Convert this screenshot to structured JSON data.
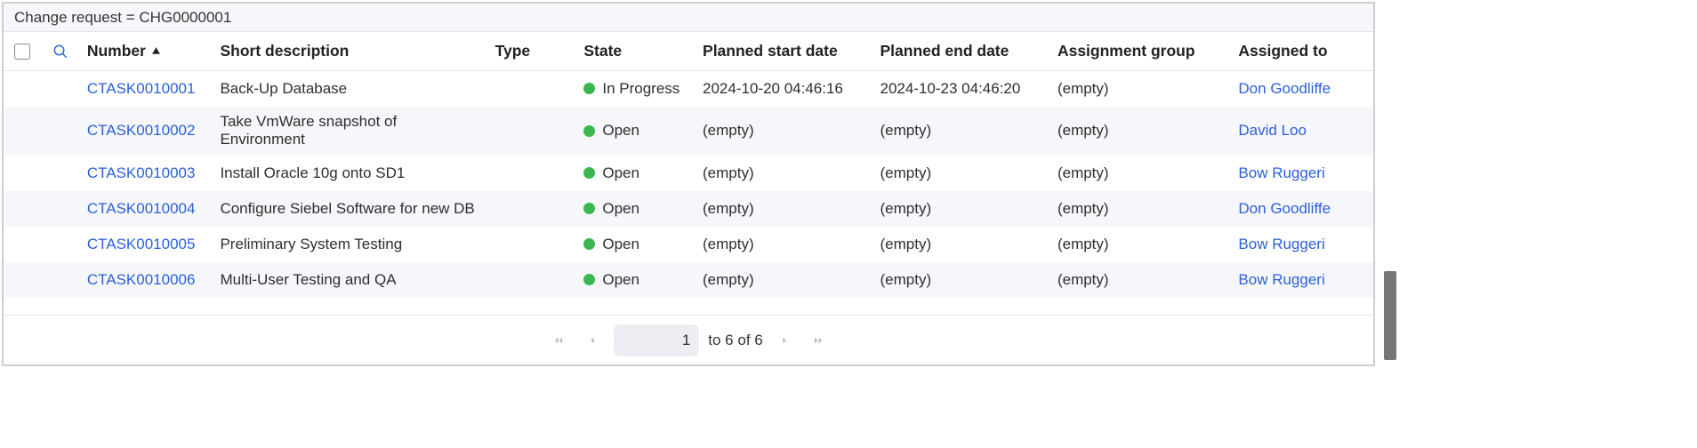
{
  "titlebar": "Change request = CHG0000001",
  "columns": {
    "number": "Number",
    "short_description": "Short description",
    "type": "Type",
    "state": "State",
    "planned_start": "Planned start date",
    "planned_end": "Planned end date",
    "assignment_group": "Assignment group",
    "assigned_to": "Assigned to"
  },
  "sort": {
    "column": "number",
    "direction": "asc"
  },
  "state_color": "#3bb650",
  "rows": [
    {
      "number": "CTASK0010001",
      "short_description": "Back-Up Database",
      "type": "",
      "state": "In Progress",
      "planned_start": "2024-10-20 04:46:16",
      "planned_end": "2024-10-23 04:46:20",
      "assignment_group": "(empty)",
      "assigned_to": "Don Goodliffe"
    },
    {
      "number": "CTASK0010002",
      "short_description": "Take VmWare snapshot of Environment",
      "type": "",
      "state": "Open",
      "planned_start": "(empty)",
      "planned_end": "(empty)",
      "assignment_group": "(empty)",
      "assigned_to": "David Loo"
    },
    {
      "number": "CTASK0010003",
      "short_description": "Install Oracle 10g onto SD1",
      "type": "",
      "state": "Open",
      "planned_start": "(empty)",
      "planned_end": "(empty)",
      "assignment_group": "(empty)",
      "assigned_to": "Bow Ruggeri"
    },
    {
      "number": "CTASK0010004",
      "short_description": "Configure Siebel Software for new DB",
      "type": "",
      "state": "Open",
      "planned_start": "(empty)",
      "planned_end": "(empty)",
      "assignment_group": "(empty)",
      "assigned_to": "Don Goodliffe"
    },
    {
      "number": "CTASK0010005",
      "short_description": "Preliminary System Testing",
      "type": "",
      "state": "Open",
      "planned_start": "(empty)",
      "planned_end": "(empty)",
      "assignment_group": "(empty)",
      "assigned_to": "Bow Ruggeri"
    },
    {
      "number": "CTASK0010006",
      "short_description": "Multi-User Testing and QA",
      "type": "",
      "state": "Open",
      "planned_start": "(empty)",
      "planned_end": "(empty)",
      "assignment_group": "(empty)",
      "assigned_to": "Bow Ruggeri"
    }
  ],
  "pagination": {
    "current_page": "1",
    "suffix": "to 6 of 6"
  }
}
